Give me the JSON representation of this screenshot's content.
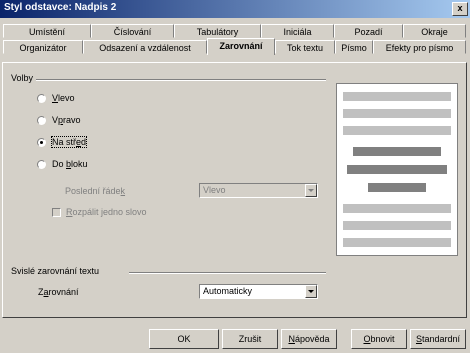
{
  "window": {
    "title": "Styl odstavce: Nadpis 2",
    "close": "x"
  },
  "tabs_row1": [
    "Umístění",
    "Číslování",
    "Tabulátory",
    "Iniciála",
    "Pozadí",
    "Okraje"
  ],
  "tabs_row2": [
    "Organizátor",
    "Odsazení a vzdálenost",
    "Zarovnání",
    "Tok textu",
    "Písmo",
    "Efekty pro písmo"
  ],
  "active_tab": "Zarovnání",
  "options": {
    "group_label": "Volby",
    "radios": [
      {
        "label": "Vlevo",
        "selected": false
      },
      {
        "label": "Vpravo",
        "selected": false
      },
      {
        "label": "Na střed",
        "selected": true
      },
      {
        "label": "Do bloku",
        "selected": false
      }
    ],
    "last_line_label": "Poslední řádek",
    "last_line_value": "Vlevo",
    "expand_word_label": "Rozpálit jedno slovo"
  },
  "vertical": {
    "group_label": "Svislé zarovnání textu",
    "align_label": "Zarovnání",
    "align_value": "Automaticky"
  },
  "buttons": {
    "ok": "OK",
    "cancel": "Zrušit",
    "help": "Nápověda",
    "reset": "Obnovit",
    "standard": "Standardní"
  }
}
